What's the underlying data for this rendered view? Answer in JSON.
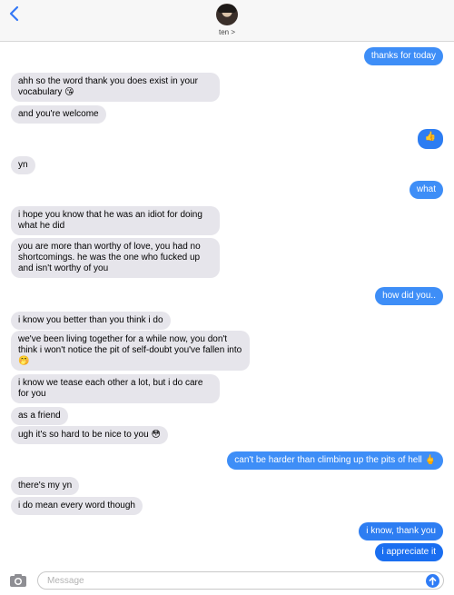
{
  "header": {
    "back_icon": "chevron-left-icon",
    "contact_name": "ten >",
    "accent": "#3478f6"
  },
  "messages": [
    {
      "side": "sent",
      "text": "thanks for today"
    },
    {
      "side": "received",
      "text": "ahh so the word thank you does exist in your vocabulary 😘"
    },
    {
      "side": "received",
      "text": "and you're welcome"
    },
    {
      "side": "sent",
      "text": "👍"
    },
    {
      "side": "received",
      "text": "yn"
    },
    {
      "side": "sent",
      "text": "what"
    },
    {
      "side": "received",
      "text": "i hope you know that he was an idiot for doing what he did"
    },
    {
      "side": "received",
      "text": "you are more than worthy of love, you had no shortcomings. he was the one who fucked up and isn't worthy of you"
    },
    {
      "side": "sent",
      "text": "how did you.."
    },
    {
      "side": "received",
      "text": "i know you better than you think i do"
    },
    {
      "side": "received",
      "text": "we've been living together for a while now, you don't think i won't notice the pit of self-doubt you've fallen into 🤭"
    },
    {
      "side": "received",
      "text": "i know we tease each other a lot, but i do care for you"
    },
    {
      "side": "received",
      "text": "as a friend"
    },
    {
      "side": "received",
      "text": "ugh it's so hard to be nice to you 😳"
    },
    {
      "side": "sent",
      "text": "can't be harder than climbing up the pits of hell 🖕"
    },
    {
      "side": "received",
      "text": "there's my yn"
    },
    {
      "side": "received",
      "text": "i do mean every word though"
    },
    {
      "side": "sent",
      "text": "i know, thank you"
    },
    {
      "side": "sent",
      "text": "i appreciate it"
    }
  ],
  "composer": {
    "placeholder": "Message",
    "camera_icon": "camera-icon",
    "send_icon": "send-arrow-icon"
  },
  "colors": {
    "sent_bubble": "#3e8ef7",
    "received_bubble": "#e6e5eb",
    "send_button": "#2f7cf6"
  }
}
